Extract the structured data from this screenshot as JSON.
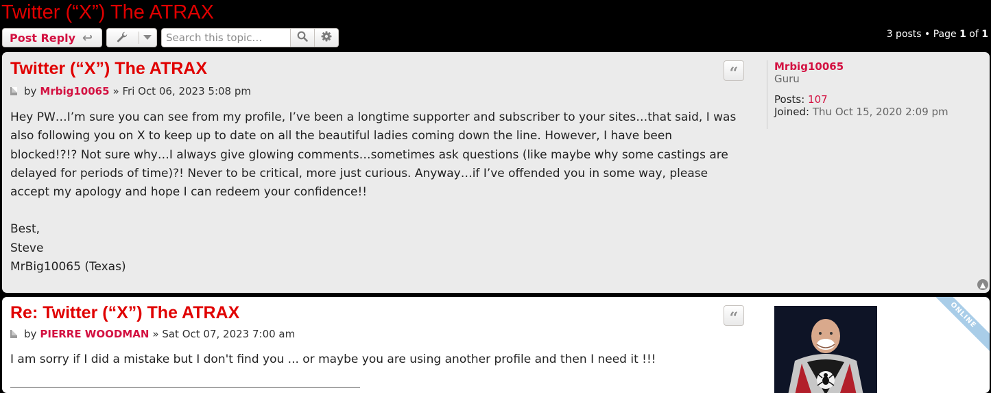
{
  "topic": {
    "title": "Twitter (“X”) The ATRAX"
  },
  "action_bar": {
    "post_reply_label": "Post Reply",
    "search_placeholder": "Search this topic…",
    "pagination": {
      "posts_text": "3 posts • Page ",
      "current": "1",
      "of_text": " of ",
      "total": "1"
    }
  },
  "posts": [
    {
      "title": "Twitter (“X”) The ATRAX",
      "by": "by",
      "author": "Mrbig10065",
      "date": "» Fri Oct 06, 2023 5:08 pm",
      "content": [
        "Hey PW…I’m sure you can see from my profile, I’ve been a longtime supporter and subscriber to your sites…that said, I was also following you on X to keep up to date on all the beautiful ladies coming down the line. However, I have been blocked!?!? Not sure why…I always give glowing comments…sometimes ask questions (like maybe why some castings are delayed for periods of time)?! Never to be critical, more just curious. Anyway…if I’ve offended you in some way, please accept my apology and hope I can redeem your confidence!!",
        "Best,",
        "Steve",
        "MrBig10065 (Texas)"
      ],
      "profile": {
        "username": "Mrbig10065",
        "rank": "Guru",
        "posts_label": "Posts:",
        "posts_value": "107",
        "joined_label": "Joined:",
        "joined_value": "Thu Oct 15, 2020 2:09 pm"
      }
    },
    {
      "title": "Re: Twitter (“X”) The ATRAX",
      "by": "by",
      "author": "PIERRE WOODMAN",
      "date": "» Sat Oct 07, 2023 7:00 am",
      "content": [
        "I am sorry if I did a mistake but I don't find you ... or maybe you are using another profile and then I need it !!!"
      ],
      "online_badge": "ONLINE"
    }
  ],
  "colors": {
    "accent": "#e00000",
    "link": "#d31141",
    "background": "#000000"
  }
}
